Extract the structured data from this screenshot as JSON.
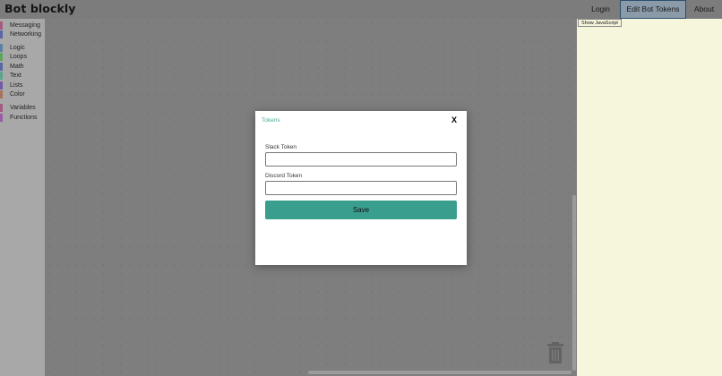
{
  "app": {
    "title": "Bot blockly"
  },
  "nav": {
    "login": "Login",
    "edit_tokens": "Edit Bot Tokens",
    "about": "About"
  },
  "toolbox": {
    "items": [
      {
        "label": "Messaging",
        "color": "#a55b80"
      },
      {
        "label": "Networking",
        "color": "#5b67a5"
      },
      {
        "label": "Logic",
        "color": "#5b80a5"
      },
      {
        "label": "Loops",
        "color": "#5ba55b"
      },
      {
        "label": "Math",
        "color": "#5b67a5"
      },
      {
        "label": "Text",
        "color": "#5ba58c"
      },
      {
        "label": "Lists",
        "color": "#745ba5"
      },
      {
        "label": "Color",
        "color": "#a5745b"
      },
      {
        "label": "Variables",
        "color": "#a55b80"
      },
      {
        "label": "Functions",
        "color": "#995ba5"
      }
    ]
  },
  "workspace": {
    "trash_icon": "trash-icon"
  },
  "right_pane": {
    "show_js_label": "Show JavaScript"
  },
  "modal": {
    "title": "Tokens",
    "close_label": "X",
    "slack_label": "Slack Token",
    "slack_value": "",
    "discord_label": "Discord Token",
    "discord_value": "",
    "save_label": "Save"
  },
  "colors": {
    "accent": "#3a9e8e",
    "title_accent": "#4aa89a"
  }
}
